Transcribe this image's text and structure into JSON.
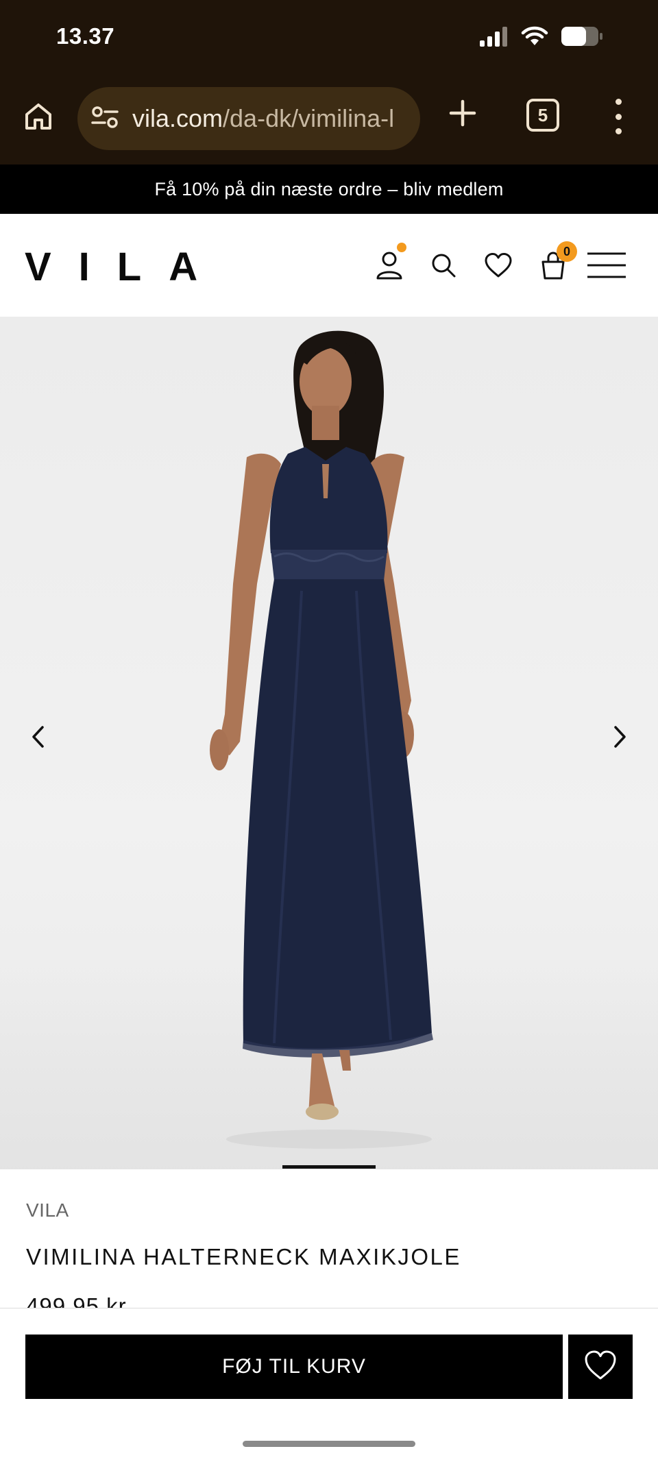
{
  "status_bar": {
    "time": "13.37"
  },
  "browser": {
    "url_host": "vila.com",
    "url_path": "/da-dk/vimilina-l",
    "tab_count": "5"
  },
  "promo": {
    "text": "Få 10% på din næste ordre – bliv medlem"
  },
  "header": {
    "logo": "VILA",
    "cart_count": "0"
  },
  "gallery": {
    "slide_count": null
  },
  "product": {
    "brand": "VILA",
    "name": "VIMILINA HALTERNECK MAXIKJOLE",
    "price": "499,95 kr."
  },
  "actions": {
    "add_to_cart": "FØJ TIL KURV"
  },
  "colors": {
    "chrome_bg": "#1f1409",
    "url_pill_bg": "#3d2c14",
    "accent_orange": "#f39a1e",
    "dress_navy": "#1c2540",
    "button_black": "#000000"
  },
  "icons": [
    "signal-icon",
    "wifi-icon",
    "battery-icon",
    "home-icon",
    "site-settings-icon",
    "plus-icon",
    "tabs-icon",
    "more-icon",
    "account-icon",
    "search-icon",
    "wishlist-icon",
    "bag-icon",
    "menu-icon",
    "chevron-left-icon",
    "chevron-right-icon",
    "heart-icon"
  ]
}
